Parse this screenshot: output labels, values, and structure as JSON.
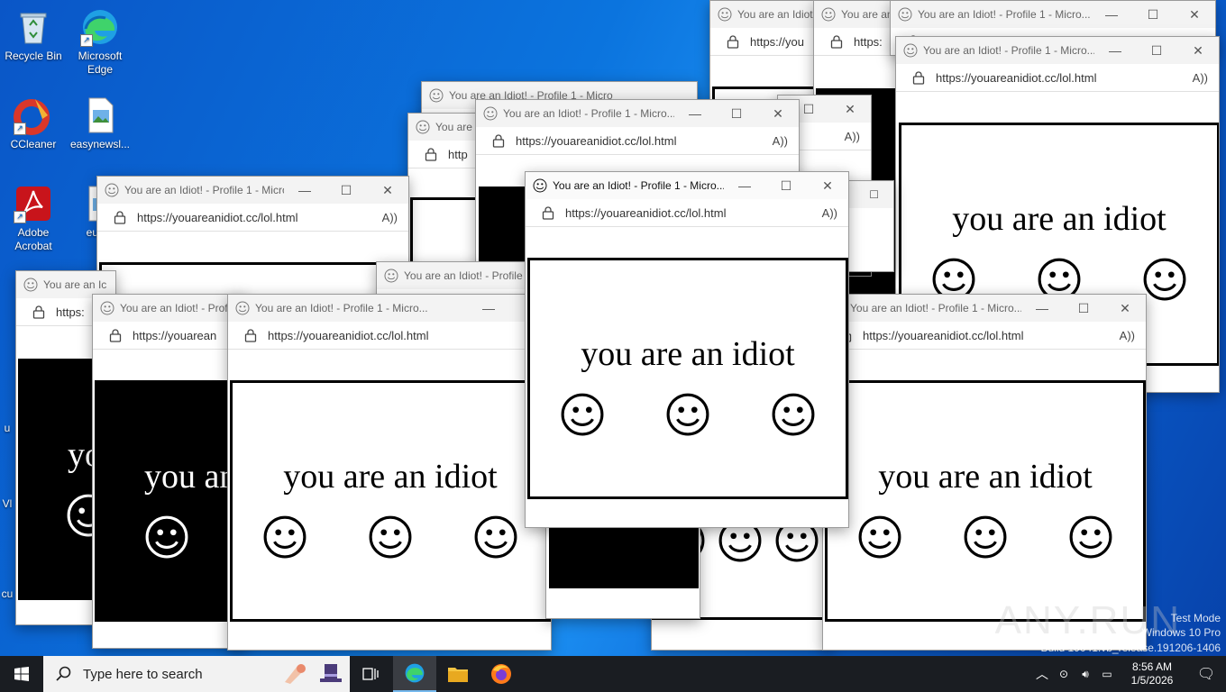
{
  "desktop": {
    "icons": [
      {
        "label": "Recycle Bin",
        "icon": "recycle-bin-icon"
      },
      {
        "label": "Microsoft Edge",
        "icon": "edge-icon"
      },
      {
        "label": "CCleaner",
        "icon": "ccleaner-icon"
      },
      {
        "label": "easynewsl...",
        "icon": "image-file-icon"
      },
      {
        "label": "Adobe Acrobat",
        "icon": "acrobat-icon"
      },
      {
        "label": "europ",
        "icon": "file-icon"
      }
    ],
    "partial_labels": [
      "u",
      "Vl",
      "cu"
    ]
  },
  "popup": {
    "title": "You are an Idiot! - Profile 1 - Micro...",
    "title_short_1": "You are an Idiot!",
    "title_short_2": "You are an",
    "title_short_3": "You are an Idiot! - Profile 1 - Micro",
    "title_short_4": "You are an Idiot! - Profi",
    "title_short_5": "You are an Idiot! - Profile",
    "title_short_6": "You are an Idiot! - Profile 1 - Micro...",
    "title_short_7": "You are",
    "title_short_8": "You are an Ic",
    "title_short_9": "You are an Idiot! - Profile 1 - Micro...",
    "url": "https://youareanidiot.cc/lol.html",
    "url_short_1": "https://you",
    "url_short_2": "https:",
    "url_short_3": "https://youarean",
    "url_short_4": "http",
    "url_short_5": "https:",
    "message": "you are an idiot",
    "message_partial_1": "you an",
    "message_partial_2": "yo",
    "read_aloud_glyph": "A ⁾"
  },
  "taskbar": {
    "search_placeholder": "Type here to search",
    "time": "8:56 AM",
    "date": "1/5/2026"
  },
  "watermark": {
    "line1": "Test Mode",
    "line2": "Windows 10 Pro",
    "line3": "Build 19041.vb_release.191206-1406",
    "brand": "ANY.RUN"
  }
}
